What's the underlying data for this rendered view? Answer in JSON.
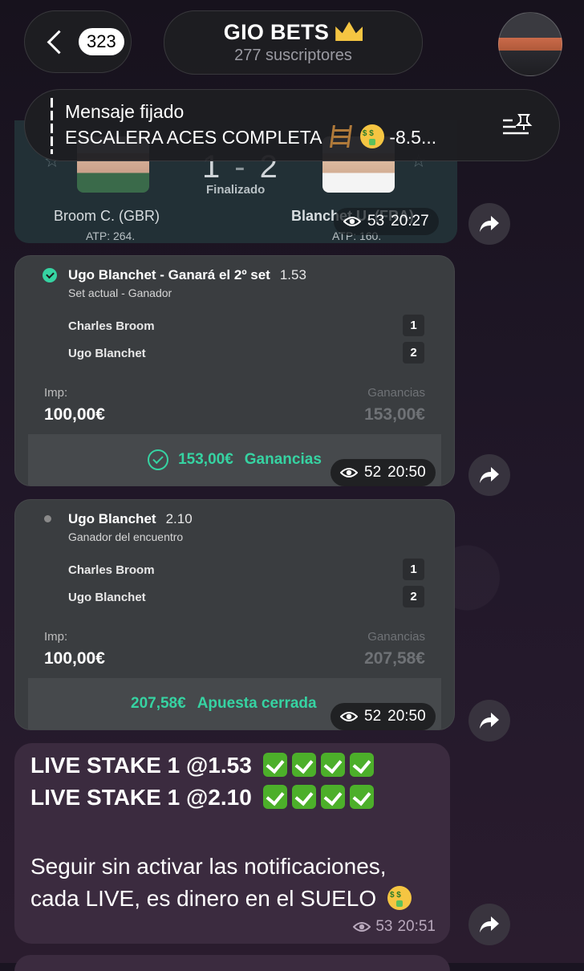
{
  "header": {
    "unread_count": "323",
    "channel_name": "GIO BETS",
    "subscribers": "277 suscriptores"
  },
  "pinned": {
    "title": "Mensaje fijado",
    "text": "ESCALERA ACES COMPLETA",
    "text_suffix": "-8.5..."
  },
  "match_card": {
    "score_left": "1",
    "score_right": "2",
    "status": "Finalizado",
    "player_left": "Broom C. (GBR)",
    "player_left_rank": "ATP: 264.",
    "player_right": "Blanchet U. (FRA)",
    "player_right_rank": "ATP: 160.",
    "views": "53",
    "time": "20:27"
  },
  "bet1": {
    "title": "Ugo Blanchet - Ganará el 2º set",
    "odds": "1.53",
    "market": "Set actual - Ganador",
    "players": [
      {
        "name": "Charles Broom",
        "num": "1"
      },
      {
        "name": "Ugo Blanchet",
        "num": "2"
      }
    ],
    "imp_label": "Imp:",
    "imp_value": "100,00€",
    "gan_label": "Ganancias",
    "gan_value": "153,00€",
    "footer_amount": "153,00€",
    "footer_label": "Ganancias",
    "views": "52",
    "time": "20:50"
  },
  "bet2": {
    "title": "Ugo Blanchet",
    "odds": "2.10",
    "market": "Ganador del encuentro",
    "players": [
      {
        "name": "Charles Broom",
        "num": "1"
      },
      {
        "name": "Ugo Blanchet",
        "num": "2"
      }
    ],
    "imp_label": "Imp:",
    "imp_value": "100,00€",
    "gan_label": "Ganancias",
    "gan_value": "207,58€",
    "footer_amount": "207,58€",
    "footer_label": "Apuesta cerrada",
    "views": "52",
    "time": "20:50"
  },
  "text_message": {
    "line1": "LIVE STAKE 1 @1.53",
    "line2": "LIVE STAKE 1 @2.10",
    "line3": "Seguir sin activar las notificaciones,",
    "line4": "cada LIVE, es dinero en el SUELO",
    "views": "53",
    "time": "20:51"
  },
  "colors": {
    "accent_green": "#36d3a2",
    "bubble": "#3b2b3f",
    "bet_card": "#3a3d40"
  },
  "icons": [
    "back-chevron-icon",
    "crown-icon",
    "pin-list-icon",
    "eye-icon",
    "share-icon",
    "check-icon",
    "ladder-icon",
    "money-face-icon"
  ]
}
